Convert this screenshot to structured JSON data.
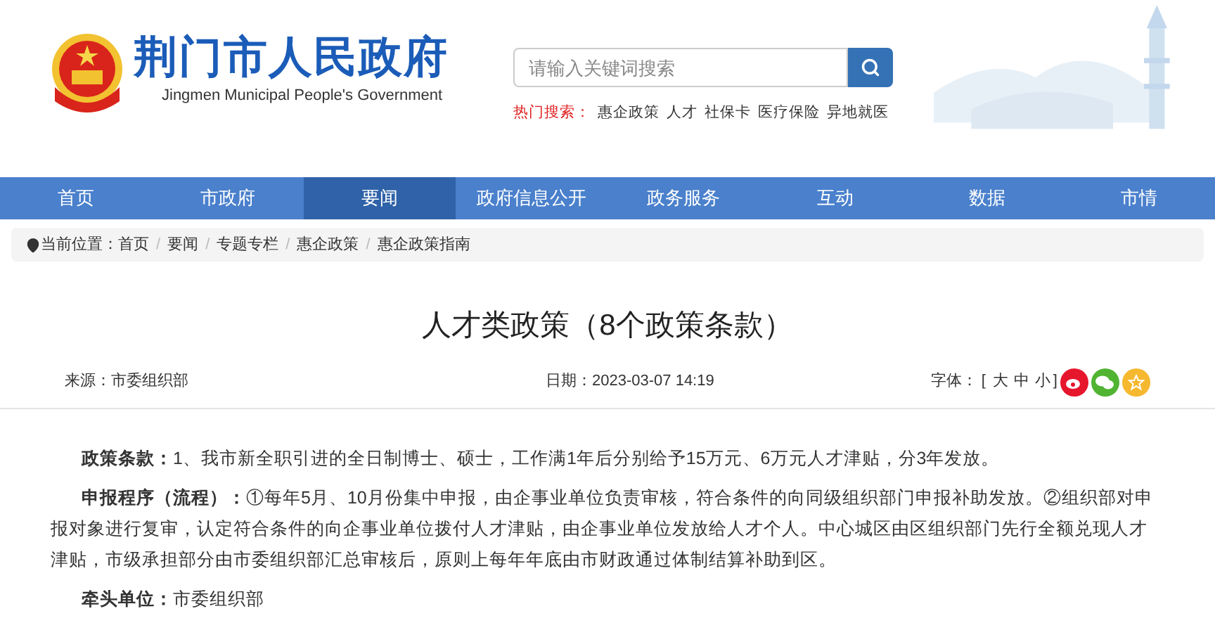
{
  "header": {
    "site_title": "荆门市人民政府",
    "site_subtitle": "Jingmen Municipal People's Government",
    "search": {
      "placeholder": "请输入关键词搜索"
    },
    "hot_label": "热门搜索：",
    "hot_items": [
      "惠企政策",
      "人才",
      "社保卡",
      "医疗保险",
      "异地就医"
    ]
  },
  "nav": [
    {
      "label": "首页",
      "selected": false
    },
    {
      "label": "市政府",
      "selected": false
    },
    {
      "label": "要闻",
      "selected": true
    },
    {
      "label": "政府信息公开",
      "selected": false
    },
    {
      "label": "政务服务",
      "selected": false
    },
    {
      "label": "互动",
      "selected": false
    },
    {
      "label": "数据",
      "selected": false
    },
    {
      "label": "市情",
      "selected": false
    }
  ],
  "breadcrumb": {
    "label": "当前位置：",
    "separator": "/",
    "items": [
      "首页",
      "要闻",
      "专题专栏",
      "惠企政策",
      "惠企政策指南"
    ]
  },
  "article": {
    "title": "人才类政策（8个政策条款）",
    "source": "来源：市委组织部",
    "date": "日期：2023-03-07 14:19",
    "font_label": "字体：",
    "bracket_open": "[",
    "bracket_close": "]",
    "font_sizes": [
      "大",
      "中",
      "小"
    ],
    "paragraphs": [
      "**政策条款：**1、我市新全职引进的全日制博士、硕士，工作满1年后分别给予15万元、6万元人才津贴，分3年发放。",
      "**申报程序（流程）：**①每年5月、10月份集中申报，由企事业单位负责审核，符合条件的向同级组织部门申报补助发放。②组织部对申报对象进行复审，认定符合条件的向企事业单位拨付人才津贴，由企事业单位发放给人才个人。中心城区由区组织部门先行全额兑现人才津贴，市级承担部分由市委组织部汇总审核后，原则上每年年底由市财政通过体制结算补助到区。",
      "**牵头单位：**市委组织部"
    ]
  }
}
